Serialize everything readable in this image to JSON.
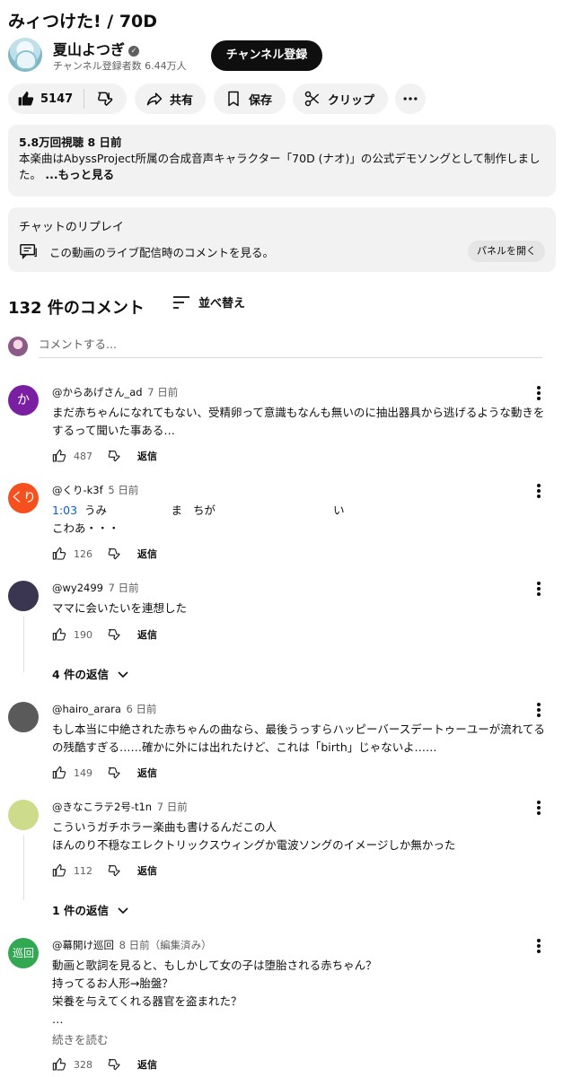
{
  "video": {
    "title": "みィつけた! / 70D",
    "channel_name": "夏山よつぎ",
    "verified_mark": "✓",
    "subscribers": "チャンネル登録者数 6.44万人",
    "subscribe_label": "チャンネル登録",
    "like_count": "5147",
    "share_label": "共有",
    "save_label": "保存",
    "clip_label": "クリップ"
  },
  "description": {
    "meta": "5.8万回視聴  8 日前",
    "text": "本楽曲はAbyssProject所属の合成音声キャラクター「70D (ナオ)」の公式デモソングとして制作しました。",
    "more": " ...もっと見る"
  },
  "chat_replay": {
    "title": "チャットのリプレイ",
    "text": "この動画のライブ配信時のコメントを見る。",
    "button": "パネルを開く"
  },
  "comments_header": {
    "count": "132 件のコメント",
    "sort_label": "並べ替え",
    "add_placeholder": "コメントする..."
  },
  "comments": [
    {
      "avatar_text": "か",
      "avatar_color": "#7b1fa2",
      "author": "@からあげさん_ad",
      "time": "7 日前",
      "text": "まだ赤ちゃんになれてもない、受精卵って意識もなんも無いのに抽出器具から逃げるような動きをするって聞いた事ある…",
      "likes": "487",
      "reply_label": "返信"
    },
    {
      "avatar_text": "くり",
      "avatar_color": "#f4511e",
      "author": "@くり-k3f",
      "time": "5 日前",
      "timestamp_link": "1:03",
      "text": "  うみ                  ま   ちが                                 い\nこわあ・・・",
      "likes": "126",
      "reply_label": "返信"
    },
    {
      "avatar_text": "",
      "avatar_color": "#3a3550",
      "author": "@wy2499",
      "time": "7 日前",
      "text": "ママに会いたいを連想した",
      "likes": "190",
      "reply_label": "返信",
      "replies": "4 件の返信"
    },
    {
      "avatar_text": "",
      "avatar_color": "#5a5a5a",
      "author": "@hairo_arara",
      "time": "6 日前",
      "text": "もし本当に中絶された赤ちゃんの曲なら、最後うっすらハッピーバースデートゥーユーが流れてるの残酷すぎる……確かに外には出れたけど、これは「birth」じゃないよ……",
      "likes": "149",
      "reply_label": "返信"
    },
    {
      "avatar_text": "",
      "avatar_color": "#cddc8a",
      "author": "@きなこラテ2号-t1n",
      "time": "7 日前",
      "text": "こういうガチホラー楽曲も書けるんだこの人\nほんのり不穏なエレクトリックスウィングか電波ソングのイメージしか無かった",
      "likes": "112",
      "reply_label": "返信",
      "replies": "1 件の返信"
    },
    {
      "avatar_text": "巡回",
      "avatar_color": "#33a852",
      "author": "@幕開け巡回",
      "time": "8 日前（編集済み）",
      "text": "動画と歌詞を見ると、もしかして女の子は堕胎される赤ちゃん？\n持ってるお人形→胎盤？\n栄養を与えてくれる器官を盗まれた？\n…",
      "read_more": "続きを読む",
      "likes": "328",
      "reply_label": "返信"
    }
  ]
}
